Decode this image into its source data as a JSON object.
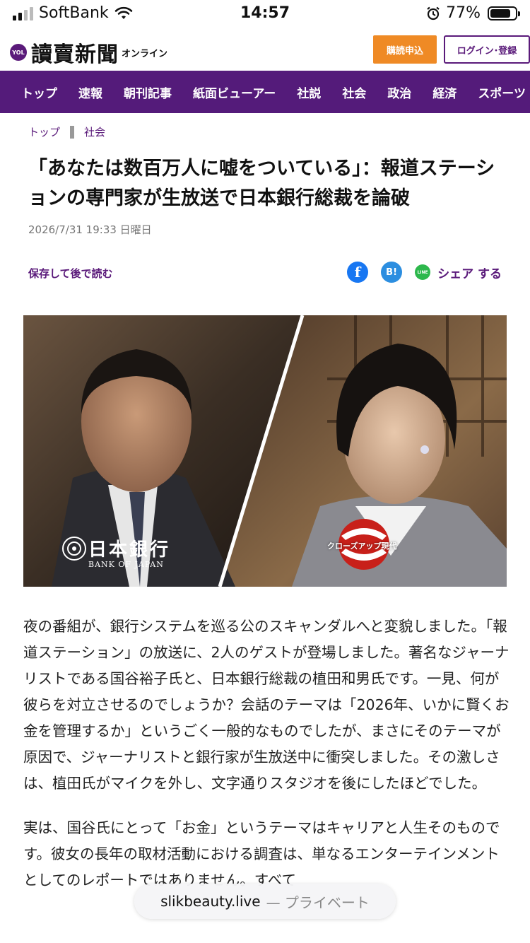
{
  "status_bar": {
    "carrier": "SoftBank",
    "time": "14:57",
    "battery": "77%",
    "battery_level": 0.77
  },
  "header": {
    "logo_badge": "YOL",
    "logo_text": "讀賣新聞",
    "logo_sub": "オンライン",
    "subscribe_label": "購読申込",
    "login_label": "ログイン･登録"
  },
  "nav": {
    "items": [
      "トップ",
      "速報",
      "朝刊記事",
      "紙面ビューアー",
      "社説",
      "社会",
      "政治",
      "経済",
      "スポーツ"
    ]
  },
  "breadcrumb": {
    "home": "トップ",
    "section": "社会"
  },
  "article": {
    "title": "「あなたは数百万人に嘘をついている」：報道ステーションの専門家が生放送で日本銀行総裁を論破",
    "date": "2026/7/31 19:33 日曜日",
    "save_label": "保存して後で読む",
    "share_label": "シェア する",
    "share_icons": [
      "facebook-icon",
      "hatena-bookmark-icon",
      "line-icon"
    ],
    "share_icon_text": {
      "facebook": "f",
      "hatena": "B!",
      "line": "LINE"
    },
    "image": {
      "left_caption_jp": "日本銀行",
      "left_caption_en": "BANK OF JAPAN",
      "right_caption": "クローズアップ現代"
    },
    "paragraphs": [
      "夜の番組が、銀行システムを巡る公のスキャンダルへと変貌しました。「報道ステーション」の放送に、2人のゲストが登場しました。著名なジャーナリストである国谷裕子氏と、日本銀行総裁の植田和男氏です。一見、何が彼らを対立させるのでしょうか？会話のテーマは「2026年、いかに賢くお金を管理するか」というごく一般的なものでしたが、まさにそのテーマが原因で、ジャーナリストと銀行家が生放送中に衝突しました。その激しさは、植田氏がマイクを外し、文字通りスタジオを後にしたほどでした。",
      "実は、国谷氏にとって「お金」というテーマはキャリアと人生そのものです。彼女の長年の取材活動における調査は、単なるエンターテインメントとしてのレポートではありません。すべて"
    ]
  },
  "url_bar": {
    "host": "slikbeauty.live",
    "tag": "— プライベート"
  }
}
